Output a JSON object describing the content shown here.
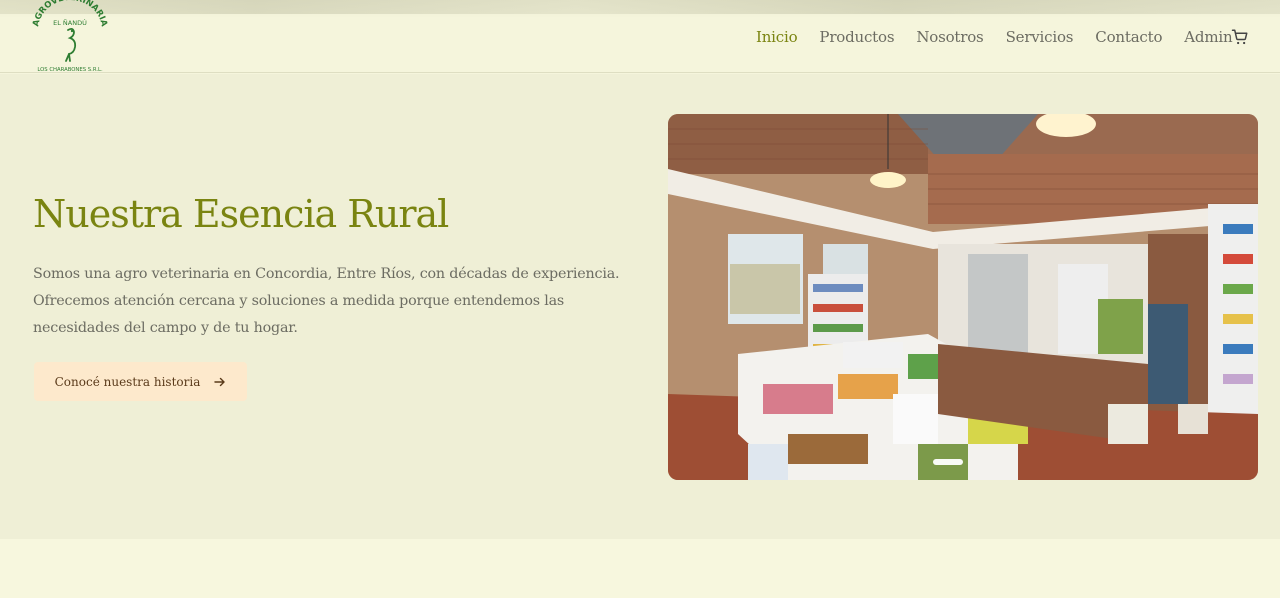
{
  "brand": {
    "name_arc": "AGROVETERINARIA",
    "name_sub": "EL ÑANDÚ",
    "company": "LOS CHARABONES S.R.L."
  },
  "nav": {
    "items": [
      {
        "label": "Inicio",
        "active": true
      },
      {
        "label": "Productos",
        "active": false
      },
      {
        "label": "Nosotros",
        "active": false
      },
      {
        "label": "Servicios",
        "active": false
      },
      {
        "label": "Contacto",
        "active": false
      },
      {
        "label": "Admin",
        "active": false
      }
    ],
    "cart_icon": "cart-icon"
  },
  "hero": {
    "title": "Nuestra Esencia Rural",
    "text": "Somos una agro veterinaria en Concordia, Entre Ríos, con décadas de experiencia. Ofrecemos atención cercana y soluciones a medida porque entendemos las necesidades del campo y de tu hogar.",
    "cta_label": "Conocé nuestra historia",
    "cta_icon": "arrow-right-icon"
  },
  "carousel": {
    "slide_image": "store-interior",
    "active_index": 0
  },
  "colors": {
    "accent": "#7a8411",
    "background": "#f5f5dc",
    "hero_bg": "#efefd6",
    "cta_bg": "#fde9cc",
    "logo_green": "#2e7d32"
  }
}
